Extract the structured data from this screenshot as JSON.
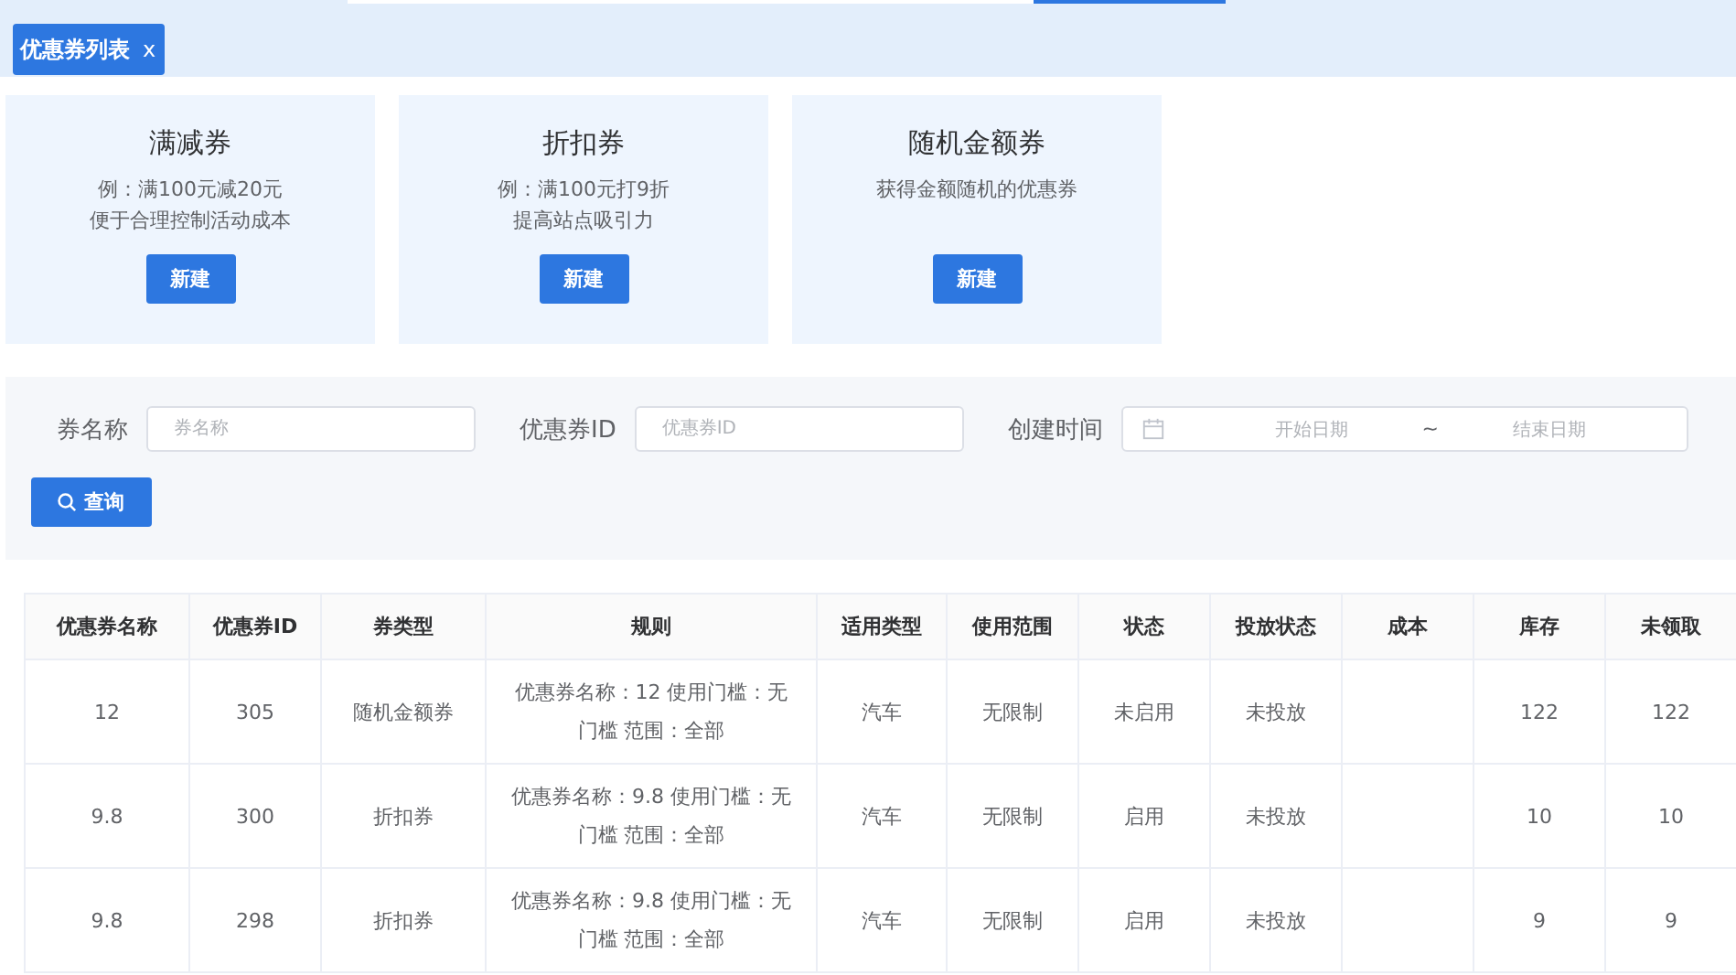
{
  "tab_strip": {
    "tabs": [
      {
        "label": "优惠券列表",
        "close": "x",
        "selected": true
      }
    ]
  },
  "coupon_types": [
    {
      "title": "满减券",
      "description": [
        "例：满100元减20元",
        "便于合理控制活动成本"
      ],
      "button": "新建"
    },
    {
      "title": "折扣券",
      "description": [
        "例：满100元打9折",
        "提高站点吸引力"
      ],
      "button": "新建"
    },
    {
      "title": "随机金额券",
      "description": [
        "获得金额随机的优惠券"
      ],
      "button": "新建"
    }
  ],
  "filters": {
    "fields": [
      {
        "kind": "text",
        "label": "券名称",
        "placeholder": "券名称"
      },
      {
        "kind": "text",
        "label": "优惠券ID",
        "placeholder": "优惠券ID"
      },
      {
        "kind": "daterange",
        "label": "创建时间",
        "start_placeholder": "开始日期",
        "separator": "~",
        "end_placeholder": "结束日期"
      }
    ],
    "search_button": "查询"
  },
  "table": {
    "columns": [
      "优惠券名称",
      "优惠券ID",
      "券类型",
      "规则",
      "适用类型",
      "使用范围",
      "状态",
      "投放状态",
      "成本",
      "库存",
      "未领取"
    ],
    "rows": [
      [
        "12",
        "305",
        "随机金额券",
        "优惠券名称：12 使用门槛：无门槛 范围：全部",
        "汽车",
        "无限制",
        "未启用",
        "未投放",
        "",
        "122",
        "122"
      ],
      [
        "9.8",
        "300",
        "折扣券",
        "优惠券名称：9.8 使用门槛：无门槛 范围：全部",
        "汽车",
        "无限制",
        "启用",
        "未投放",
        "",
        "10",
        "10"
      ],
      [
        "9.8",
        "298",
        "折扣券",
        "优惠券名称：9.8 使用门槛：无门槛 范围：全部",
        "汽车",
        "无限制",
        "启用",
        "未投放",
        "",
        "9",
        "9"
      ]
    ]
  }
}
